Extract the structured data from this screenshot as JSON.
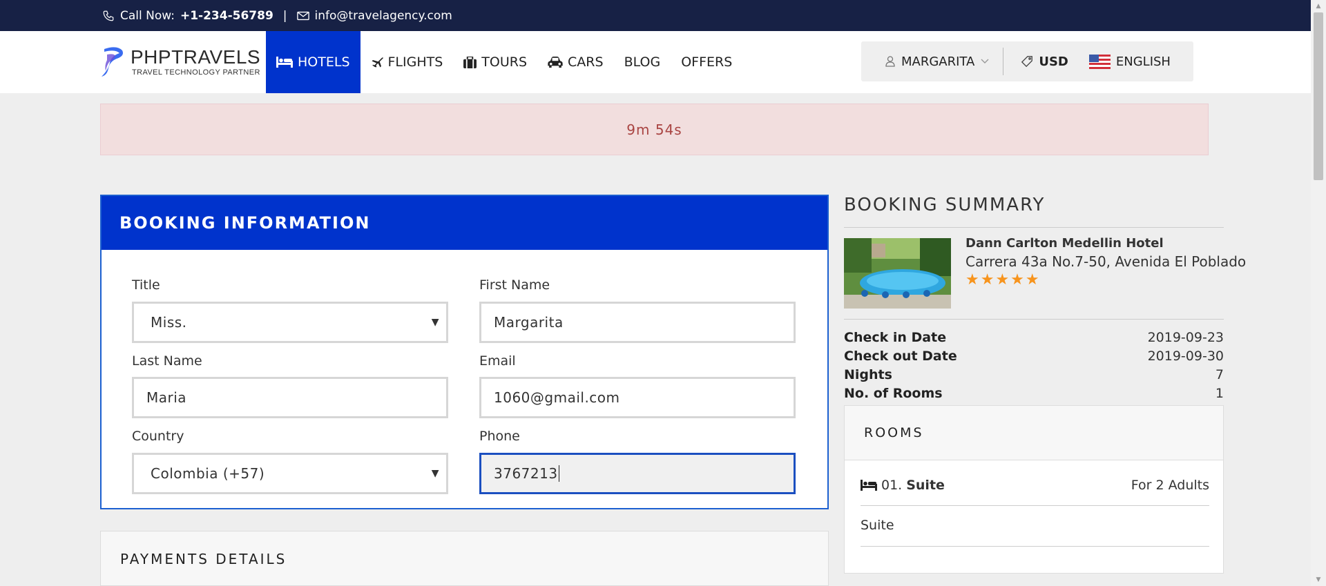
{
  "topbar": {
    "call_label": "Call Now:",
    "phone": "+1-234-56789",
    "separator": "|",
    "email": "info@travelagency.com"
  },
  "logo": {
    "title": "PHPTRAVELS",
    "subtitle": "TRAVEL TECHNOLOGY PARTNER"
  },
  "nav": {
    "items": [
      {
        "label": "HOTELS",
        "icon": "bed-icon",
        "active": true
      },
      {
        "label": "FLIGHTS",
        "icon": "plane-icon"
      },
      {
        "label": "TOURS",
        "icon": "suitcase-icon"
      },
      {
        "label": "CARS",
        "icon": "car-icon"
      },
      {
        "label": "BLOG"
      },
      {
        "label": "OFFERS"
      }
    ]
  },
  "account": {
    "user": "MARGARITA",
    "currency": "USD",
    "language": "ENGLISH"
  },
  "alert": {
    "timer": "9m 54s"
  },
  "booking": {
    "header": "BOOKING INFORMATION",
    "title_label": "Title",
    "title_value": "Miss.",
    "first_name_label": "First Name",
    "first_name_value": "Margarita",
    "last_name_label": "Last Name",
    "last_name_value": "Maria",
    "email_label": "Email",
    "email_value": "1060@gmail.com",
    "country_label": "Country",
    "country_value": "Colombia (+57)",
    "phone_label": "Phone",
    "phone_value": "3767213"
  },
  "payments": {
    "header": "PAYMENTS DETAILS"
  },
  "summary": {
    "header": "BOOKING SUMMARY",
    "hotel_name": "Dann Carlton Medellin Hotel",
    "hotel_address": "Carrera 43a No.7-50, Avenida El Poblado",
    "stars": "★★★★★",
    "rating": 5,
    "checkin_label": "Check in Date",
    "checkin_value": "2019-09-23",
    "checkout_label": "Check out Date",
    "checkout_value": "2019-09-30",
    "nights_label": "Nights",
    "nights_value": "7",
    "rooms_count_label": "No. of Rooms",
    "rooms_count_value": "1",
    "rooms_header": "ROOMS",
    "room_number": "01.",
    "room_name": "Suite",
    "room_capacity": "For 2 Adults",
    "room_type": "Suite"
  },
  "colors": {
    "topbar": "#172145",
    "primary": "#0033cc",
    "alert_bg": "#f2dede",
    "alert_text": "#a94442",
    "star": "#f7941d"
  }
}
